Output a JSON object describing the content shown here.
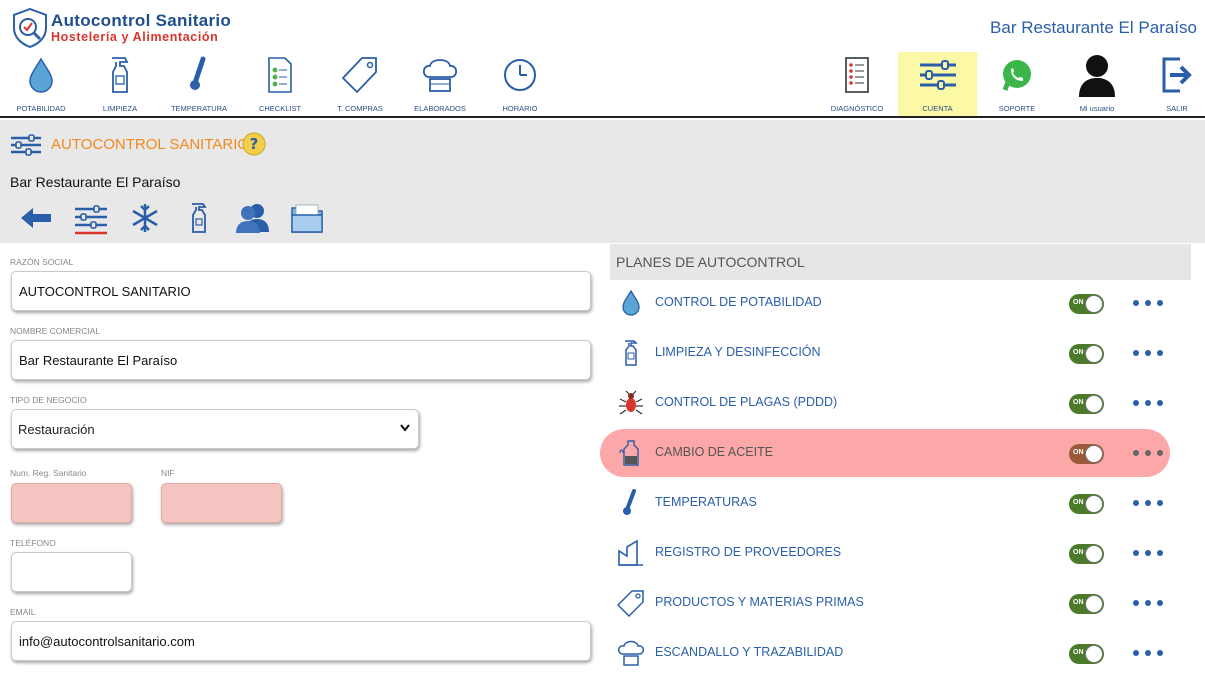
{
  "header": {
    "brand_title": "Autocontrol Sanitario",
    "brand_subtitle": "Hostelería y Alimentación",
    "business_name": "Bar Restaurante El Paraíso"
  },
  "nav_left": [
    {
      "label": "POTABILIDAD",
      "icon": "water-drop-icon"
    },
    {
      "label": "LIMPIEZA",
      "icon": "spray-bottle-icon"
    },
    {
      "label": "TEMPERATURA",
      "icon": "thermometer-icon"
    },
    {
      "label": "CHECKLIST",
      "icon": "checklist-icon"
    },
    {
      "label": "T. COMPRAS",
      "icon": "price-tag-icon"
    },
    {
      "label": "ELABORADOS",
      "icon": "chef-hat-icon"
    },
    {
      "label": "HORARIO",
      "icon": "clock-icon"
    }
  ],
  "nav_right": [
    {
      "label": "DIAGNÓSTICO",
      "icon": "diagnostic-list-icon",
      "active": false
    },
    {
      "label": "CUENTA",
      "icon": "sliders-icon",
      "active": true
    },
    {
      "label": "SOPORTE",
      "icon": "whatsapp-icon",
      "active": false
    },
    {
      "label": "Mi usuario",
      "icon": "user-icon",
      "active": false
    },
    {
      "label": "SALIR",
      "icon": "logout-icon",
      "active": false
    }
  ],
  "section": {
    "title": "AUTOCONTROL SANITARIO",
    "business_name": "Bar Restaurante El Paraíso"
  },
  "toolbar_icons": [
    "back-arrow-icon",
    "sliders-icon",
    "snowflake-icon",
    "spray-bottle-icon",
    "users-icon",
    "folder-icon"
  ],
  "form": {
    "razon_social": {
      "label": "RAZÓN SOCIAL",
      "value": "AUTOCONTROL SANITARIO"
    },
    "nombre_comercial": {
      "label": "NOMBRE COMERCIAL",
      "value": "Bar Restaurante El Paraíso"
    },
    "tipo_negocio": {
      "label": "TIPO DE NEGOCIO",
      "value": "Restauración"
    },
    "num_reg": {
      "label": "Num. Reg. Sanitario",
      "value": ""
    },
    "nif": {
      "label": "NIF",
      "value": ""
    },
    "telefono": {
      "label": "TELÉFONO",
      "value": ""
    },
    "email": {
      "label": "EMAIL",
      "value": "info@autocontrolsanitario.com"
    }
  },
  "plans": {
    "header": "PLANES DE AUTOCONTROL",
    "toggle_on_label": "ON",
    "items": [
      {
        "label": "CONTROL DE POTABILIDAD",
        "icon": "water-drop-icon",
        "on": true
      },
      {
        "label": "LIMPIEZA Y DESINFECCIÓN",
        "icon": "spray-bottle-icon",
        "on": true
      },
      {
        "label": "CONTROL DE PLAGAS (PDDD)",
        "icon": "insect-icon",
        "on": true
      },
      {
        "label": "CAMBIO DE ACEITE",
        "icon": "oil-fryer-icon",
        "on": false
      },
      {
        "label": "TEMPERATURAS",
        "icon": "thermometer-icon",
        "on": true
      },
      {
        "label": "REGISTRO DE PROVEEDORES",
        "icon": "factory-icon",
        "on": true
      },
      {
        "label": "PRODUCTOS Y MATERIAS PRIMAS",
        "icon": "price-tag-icon",
        "on": true
      },
      {
        "label": "ESCANDALLO Y TRAZABILIDAD",
        "icon": "chef-hat-icon",
        "on": true
      }
    ]
  },
  "colors": {
    "brand_blue": "#1f4e8c",
    "brand_red": "#d9362b",
    "section_orange": "#f08a1e",
    "active_nav": "#fbf8a6",
    "highlight_row": "#fda8a8",
    "toggle_on": "#4a7a2a"
  }
}
